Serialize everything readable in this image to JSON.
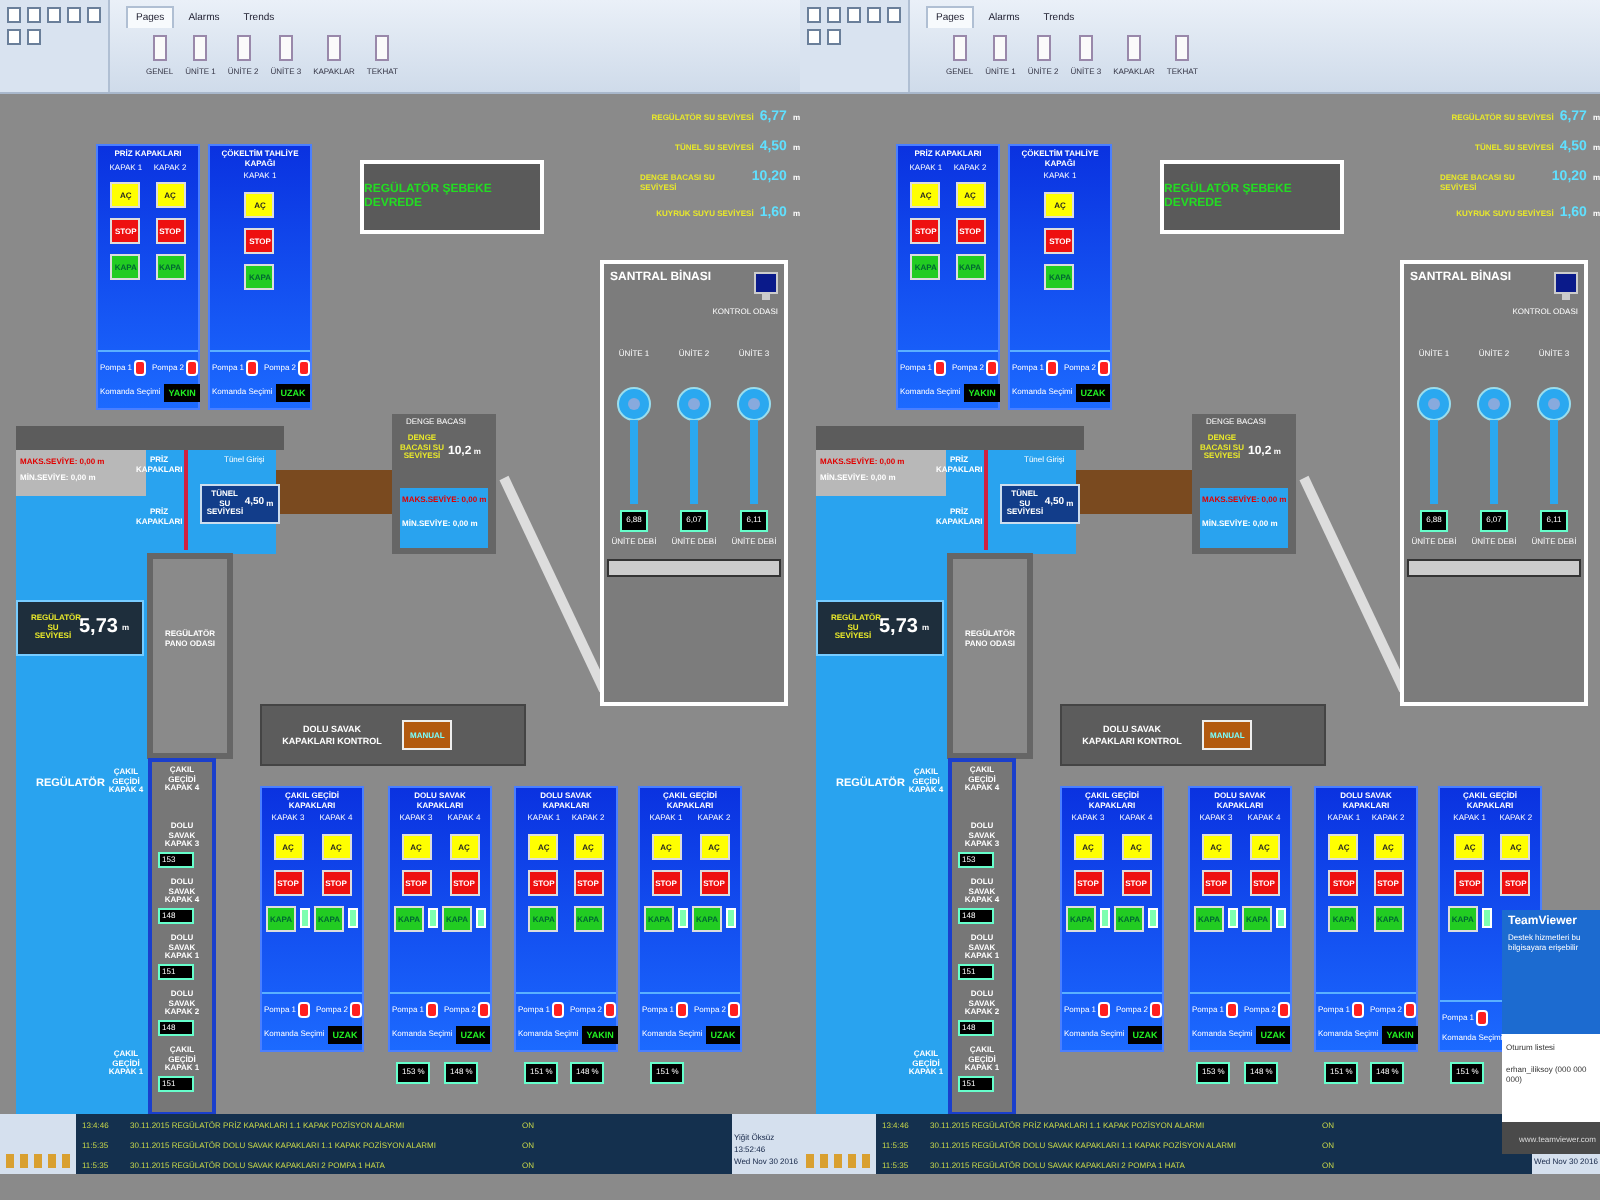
{
  "panes": [
    {
      "ribbon": {
        "tabs": [
          {
            "label": "Pages",
            "selected": true
          },
          {
            "label": "Alarms",
            "selected": false
          },
          {
            "label": "Trends",
            "selected": false
          }
        ],
        "pages": [
          "GENEL",
          "ÜNİTE 1",
          "ÜNİTE 2",
          "ÜNİTE 3",
          "KAPAKLAR",
          "TEKHAT"
        ]
      },
      "levels": [
        {
          "label": "REGÜLATÖR SU SEVİYESİ",
          "value": "6,77",
          "unit": "m"
        },
        {
          "label": "TÜNEL SU SEVİYESİ",
          "value": "4,50",
          "unit": "m"
        },
        {
          "label": "DENGE BACASI SU SEVİYESİ",
          "value": "10,20",
          "unit": "m"
        },
        {
          "label": "KUYRUK SUYU SEVİYESİ",
          "value": "1,60",
          "unit": "m"
        }
      ],
      "banner": "REGÜLATÖR ŞEBEKE DEVREDE",
      "top_panels": [
        {
          "title": "PRİZ KAPAKLARI",
          "gates": [
            {
              "label": "KAPAK 1",
              "buttons": [
                {
                  "label": "AÇ",
                  "kind": "open"
                },
                {
                  "label": "STOP",
                  "kind": "stop"
                },
                {
                  "label": "KAPA",
                  "kind": "close"
                }
              ]
            },
            {
              "label": "KAPAK 2",
              "buttons": [
                {
                  "label": "AÇ",
                  "kind": "open"
                },
                {
                  "label": "STOP",
                  "kind": "stop"
                },
                {
                  "label": "KAPA",
                  "kind": "close"
                }
              ]
            }
          ],
          "pumps": [
            {
              "label": "Pompa 1",
              "on": true
            },
            {
              "label": "Pompa 2",
              "on": true
            }
          ],
          "command": "Komanda Seçimi",
          "mode": "YAKIN"
        },
        {
          "title": "ÇÖKELTİM TAHLİYE KAPAĞI",
          "gates": [
            {
              "label": "KAPAK 1",
              "buttons": [
                {
                  "label": "AÇ",
                  "kind": "open"
                },
                {
                  "label": "STOP",
                  "kind": "stop"
                },
                {
                  "label": "KAPA",
                  "kind": "close"
                }
              ]
            }
          ],
          "pumps": [
            {
              "label": "Pompa 1",
              "on": true
            },
            {
              "label": "Pompa 2",
              "on": true
            }
          ],
          "command": "Komanda Seçimi",
          "mode": "UZAK"
        }
      ],
      "intake": {
        "max": "MAKS.SEVİYE: 0,00 m",
        "min": "MİN.SEVİYE: 0,00 m",
        "gates": [
          "PRİZ KAPAKLARI",
          "PRİZ KAPAKLARI"
        ],
        "tunnel_entry": "Tünel Girişi",
        "tunnel_label": "TÜNEL SU SEVİYESİ",
        "tunnel_value": "4,50",
        "tunnel_unit": "m"
      },
      "surge": {
        "title": "DENGE BACASI",
        "label": "DENGE BACASI SU SEVİYESİ",
        "value": "10,2",
        "unit": "m",
        "max": "MAKS.SEVİYE: 0,00 m",
        "min": "MİN.SEVİYE: 0,00 m"
      },
      "regulator": {
        "label": "REGÜLATÖR SU SEVİYESİ",
        "value": "5,73",
        "unit": "m",
        "room": "REGÜLATÖR PANO ODASI",
        "basin": "REGÜLATÖR"
      },
      "gate_column": [
        {
          "label": "ÇAKIL GEÇİDİ KAPAK 4"
        },
        {
          "label": "DOLU SAVAK KAPAK 3",
          "reading": "153"
        },
        {
          "label": "DOLU SAVAK KAPAK 4",
          "reading": "148"
        },
        {
          "label": "DOLU SAVAK KAPAK 1",
          "reading": "151"
        },
        {
          "label": "DOLU SAVAK KAPAK 2",
          "reading": "148"
        },
        {
          "label": "ÇAKIL GEÇİDİ KAPAK 1",
          "reading": "151"
        }
      ],
      "side_labels": [
        "ÇAKIL GEÇİDİ KAPAK 4",
        "ÇAKIL GEÇİDİ KAPAK 1"
      ],
      "plant": {
        "title": "SANTRAL BİNASI",
        "room": "KONTROL ODASI",
        "units": [
          {
            "label": "ÜNİTE 1",
            "reading": "6,88",
            "caption": "ÜNİTE DEBİ"
          },
          {
            "label": "ÜNİTE 2",
            "reading": "6,07",
            "caption": "ÜNİTE DEBİ"
          },
          {
            "label": "ÜNİTE 3",
            "reading": "6,11",
            "caption": "ÜNİTE DEBİ"
          }
        ]
      },
      "control": {
        "label": "DOLU SAVAK KAPAKLARI KONTROL",
        "button": "MANUAL"
      },
      "bottom_panels": [
        {
          "title": "ÇAKIL GEÇİDİ KAPAKLARI",
          "gates": [
            {
              "label": "KAPAK 3",
              "lamp": true,
              "buttons": [
                {
                  "label": "AÇ",
                  "kind": "open"
                },
                {
                  "label": "STOP",
                  "kind": "stop"
                },
                {
                  "label": "KAPA",
                  "kind": "close"
                }
              ]
            },
            {
              "label": "KAPAK 4",
              "lamp": true,
              "buttons": [
                {
                  "label": "AÇ",
                  "kind": "open"
                },
                {
                  "label": "STOP",
                  "kind": "stop"
                },
                {
                  "label": "KAPA",
                  "kind": "close"
                }
              ]
            }
          ],
          "pumps": [
            {
              "label": "Pompa 1",
              "on": true
            },
            {
              "label": "Pompa 2",
              "on": true
            }
          ],
          "command": "Komanda Seçimi",
          "mode": "UZAK"
        },
        {
          "title": "DOLU SAVAK KAPAKLARI",
          "gates": [
            {
              "label": "KAPAK 3",
              "lamp": true,
              "buttons": [
                {
                  "label": "AÇ",
                  "kind": "open"
                },
                {
                  "label": "STOP",
                  "kind": "stop"
                },
                {
                  "label": "KAPA",
                  "kind": "close"
                }
              ]
            },
            {
              "label": "KAPAK 4",
              "lamp": true,
              "buttons": [
                {
                  "label": "AÇ",
                  "kind": "open"
                },
                {
                  "label": "STOP",
                  "kind": "stop"
                },
                {
                  "label": "KAPA",
                  "kind": "close"
                }
              ]
            }
          ],
          "pumps": [
            {
              "label": "Pompa 1",
              "on": true
            },
            {
              "label": "Pompa 2",
              "on": true
            }
          ],
          "command": "Komanda Seçimi",
          "mode": "UZAK",
          "readings": [
            "153 %",
            "148 %"
          ]
        },
        {
          "title": "DOLU SAVAK KAPAKLARI",
          "gates": [
            {
              "label": "KAPAK 1",
              "buttons": [
                {
                  "label": "AÇ",
                  "kind": "open"
                },
                {
                  "label": "STOP",
                  "kind": "stop"
                },
                {
                  "label": "KAPA",
                  "kind": "close"
                }
              ]
            },
            {
              "label": "KAPAK 2",
              "buttons": [
                {
                  "label": "AÇ",
                  "kind": "open"
                },
                {
                  "label": "STOP",
                  "kind": "stop"
                },
                {
                  "label": "KAPA",
                  "kind": "close"
                }
              ]
            }
          ],
          "pumps": [
            {
              "label": "Pompa 1",
              "on": true
            },
            {
              "label": "Pompa 2",
              "on": true
            }
          ],
          "command": "Komanda Seçimi",
          "mode": "YAKIN",
          "readings": [
            "151 %",
            "148 %"
          ]
        },
        {
          "title": "ÇAKIL GEÇİDİ KAPAKLARI",
          "gates": [
            {
              "label": "KAPAK 1",
              "lamp": true,
              "buttons": [
                {
                  "label": "AÇ",
                  "kind": "open"
                },
                {
                  "label": "STOP",
                  "kind": "stop"
                },
                {
                  "label": "KAPA",
                  "kind": "close"
                }
              ]
            },
            {
              "label": "KAPAK 2",
              "lamp": true,
              "buttons": [
                {
                  "label": "AÇ",
                  "kind": "open"
                },
                {
                  "label": "STOP",
                  "kind": "stop"
                },
                {
                  "label": "KAPA",
                  "kind": "close"
                }
              ]
            }
          ],
          "pumps": [
            {
              "label": "Pompa 1",
              "on": true
            },
            {
              "label": "Pompa 2",
              "on": true
            }
          ],
          "command": "Komanda Seçimi",
          "mode": "UZAK",
          "readings": [
            "151 %"
          ]
        }
      ],
      "alarms": [
        {
          "time": "13:4:46",
          "text": "30.11.2015 REGÜLATÖR PRİZ KAPAKLARI 1.1 KAPAK POZİSYON ALARMI",
          "state": "ON"
        },
        {
          "time": "11:5:35",
          "text": "30.11.2015 REGÜLATÖR DOLU SAVAK KAPAKLARI 1.1 KAPAK POZİSYON ALARMI",
          "state": "ON"
        },
        {
          "time": "11:5:35",
          "text": "30.11.2015 REGÜLATÖR DOLU SAVAK KAPAKLARI 2 POMPA 1 HATA",
          "state": "ON"
        }
      ],
      "status": {
        "user": "Yiğit Öksüz",
        "time": "13:52:46",
        "date": "Wed Nov 30 2016"
      }
    },
    {
      "ribbon": {
        "tabs": [
          {
            "label": "Pages",
            "selected": true
          },
          {
            "label": "Alarms",
            "selected": false
          },
          {
            "label": "Trends",
            "selected": false
          }
        ],
        "pages": [
          "GENEL",
          "ÜNİTE 1",
          "ÜNİTE 2",
          "ÜNİTE 3",
          "KAPAKLAR",
          "TEKHAT"
        ]
      },
      "levels": [
        {
          "label": "REGÜLATÖR SU SEVİYESİ",
          "value": "6,77",
          "unit": "m"
        },
        {
          "label": "TÜNEL SU SEVİYESİ",
          "value": "4,50",
          "unit": "m"
        },
        {
          "label": "DENGE BACASI SU SEVİYESİ",
          "value": "10,20",
          "unit": "m"
        },
        {
          "label": "KUYRUK SUYU SEVİYESİ",
          "value": "1,60",
          "unit": "m"
        }
      ],
      "banner": "REGÜLATÖR ŞEBEKE DEVREDE",
      "top_panels": [
        {
          "title": "PRİZ KAPAKLARI",
          "gates": [
            {
              "label": "KAPAK 1",
              "buttons": [
                {
                  "label": "AÇ",
                  "kind": "open"
                },
                {
                  "label": "STOP",
                  "kind": "stop"
                },
                {
                  "label": "KAPA",
                  "kind": "close"
                }
              ]
            },
            {
              "label": "KAPAK 2",
              "buttons": [
                {
                  "label": "AÇ",
                  "kind": "open"
                },
                {
                  "label": "STOP",
                  "kind": "stop"
                },
                {
                  "label": "KAPA",
                  "kind": "close"
                }
              ]
            }
          ],
          "pumps": [
            {
              "label": "Pompa 1",
              "on": true
            },
            {
              "label": "Pompa 2",
              "on": true
            }
          ],
          "command": "Komanda Seçimi",
          "mode": "YAKIN"
        },
        {
          "title": "ÇÖKELTİM TAHLİYE KAPAĞI",
          "gates": [
            {
              "label": "KAPAK 1",
              "buttons": [
                {
                  "label": "AÇ",
                  "kind": "open"
                },
                {
                  "label": "STOP",
                  "kind": "stop"
                },
                {
                  "label": "KAPA",
                  "kind": "close"
                }
              ]
            }
          ],
          "pumps": [
            {
              "label": "Pompa 1",
              "on": true
            },
            {
              "label": "Pompa 2",
              "on": true
            }
          ],
          "command": "Komanda Seçimi",
          "mode": "UZAK"
        }
      ],
      "intake": {
        "max": "MAKS.SEVİYE: 0,00 m",
        "min": "MİN.SEVİYE: 0,00 m",
        "gates": [
          "PRİZ KAPAKLARI",
          "PRİZ KAPAKLARI"
        ],
        "tunnel_entry": "Tünel Girişi",
        "tunnel_label": "TÜNEL SU SEVİYESİ",
        "tunnel_value": "4,50",
        "tunnel_unit": "m"
      },
      "surge": {
        "title": "DENGE BACASI",
        "label": "DENGE BACASI SU SEVİYESİ",
        "value": "10,2",
        "unit": "m",
        "max": "MAKS.SEVİYE: 0,00 m",
        "min": "MİN.SEVİYE: 0,00 m"
      },
      "regulator": {
        "label": "REGÜLATÖR SU SEVİYESİ",
        "value": "5,73",
        "unit": "m",
        "room": "REGÜLATÖR PANO ODASI",
        "basin": "REGÜLATÖR"
      },
      "gate_column": [
        {
          "label": "ÇAKIL GEÇİDİ KAPAK 4"
        },
        {
          "label": "DOLU SAVAK KAPAK 3",
          "reading": "153"
        },
        {
          "label": "DOLU SAVAK KAPAK 4",
          "reading": "148"
        },
        {
          "label": "DOLU SAVAK KAPAK 1",
          "reading": "151"
        },
        {
          "label": "DOLU SAVAK KAPAK 2",
          "reading": "148"
        },
        {
          "label": "ÇAKIL GEÇİDİ KAPAK 1",
          "reading": "151"
        }
      ],
      "side_labels": [
        "ÇAKIL GEÇİDİ KAPAK 4",
        "ÇAKIL GEÇİDİ KAPAK 1"
      ],
      "plant": {
        "title": "SANTRAL BİNASI",
        "room": "KONTROL ODASI",
        "units": [
          {
            "label": "ÜNİTE 1",
            "reading": "6,88",
            "caption": "ÜNİTE DEBİ"
          },
          {
            "label": "ÜNİTE 2",
            "reading": "6,07",
            "caption": "ÜNİTE DEBİ"
          },
          {
            "label": "ÜNİTE 3",
            "reading": "6,11",
            "caption": "ÜNİTE DEBİ"
          }
        ]
      },
      "control": {
        "label": "DOLU SAVAK KAPAKLARI KONTROL",
        "button": "MANUAL"
      },
      "bottom_panels": [
        {
          "title": "ÇAKIL GEÇİDİ KAPAKLARI",
          "gates": [
            {
              "label": "KAPAK 3",
              "lamp": true,
              "buttons": [
                {
                  "label": "AÇ",
                  "kind": "open"
                },
                {
                  "label": "STOP",
                  "kind": "stop"
                },
                {
                  "label": "KAPA",
                  "kind": "close"
                }
              ]
            },
            {
              "label": "KAPAK 4",
              "lamp": true,
              "buttons": [
                {
                  "label": "AÇ",
                  "kind": "open"
                },
                {
                  "label": "STOP",
                  "kind": "stop"
                },
                {
                  "label": "KAPA",
                  "kind": "close"
                }
              ]
            }
          ],
          "pumps": [
            {
              "label": "Pompa 1",
              "on": true
            },
            {
              "label": "Pompa 2",
              "on": true
            }
          ],
          "command": "Komanda Seçimi",
          "mode": "UZAK"
        },
        {
          "title": "DOLU SAVAK KAPAKLARI",
          "gates": [
            {
              "label": "KAPAK 3",
              "lamp": true,
              "buttons": [
                {
                  "label": "AÇ",
                  "kind": "open"
                },
                {
                  "label": "STOP",
                  "kind": "stop"
                },
                {
                  "label": "KAPA",
                  "kind": "close"
                }
              ]
            },
            {
              "label": "KAPAK 4",
              "lamp": true,
              "buttons": [
                {
                  "label": "AÇ",
                  "kind": "open"
                },
                {
                  "label": "STOP",
                  "kind": "stop"
                },
                {
                  "label": "KAPA",
                  "kind": "close"
                }
              ]
            }
          ],
          "pumps": [
            {
              "label": "Pompa 1",
              "on": true
            },
            {
              "label": "Pompa 2",
              "on": true
            }
          ],
          "command": "Komanda Seçimi",
          "mode": "UZAK",
          "readings": [
            "153 %",
            "148 %"
          ]
        },
        {
          "title": "DOLU SAVAK KAPAKLARI",
          "gates": [
            {
              "label": "KAPAK 1",
              "buttons": [
                {
                  "label": "AÇ",
                  "kind": "open"
                },
                {
                  "label": "STOP",
                  "kind": "stop"
                },
                {
                  "label": "KAPA",
                  "kind": "close"
                }
              ]
            },
            {
              "label": "KAPAK 2",
              "buttons": [
                {
                  "label": "AÇ",
                  "kind": "open"
                },
                {
                  "label": "STOP",
                  "kind": "stop"
                },
                {
                  "label": "KAPA",
                  "kind": "close"
                }
              ]
            }
          ],
          "pumps": [
            {
              "label": "Pompa 1",
              "on": true
            },
            {
              "label": "Pompa 2",
              "on": true
            }
          ],
          "command": "Komanda Seçimi",
          "mode": "YAKIN",
          "readings": [
            "151 %",
            "148 %"
          ]
        },
        {
          "title": "ÇAKIL GEÇİDİ KAPAKLARI",
          "gates": [
            {
              "label": "KAPAK 1",
              "lamp": true,
              "buttons": [
                {
                  "label": "AÇ",
                  "kind": "open"
                },
                {
                  "label": "STOP",
                  "kind": "stop"
                },
                {
                  "label": "KAPA",
                  "kind": "close"
                }
              ]
            },
            {
              "label": "KAPAK 2",
              "buttons": [
                {
                  "label": "AÇ",
                  "kind": "open"
                },
                {
                  "label": "STOP",
                  "kind": "stop"
                }
              ]
            }
          ],
          "pumps": [
            {
              "label": "Pompa 1",
              "on": true
            }
          ],
          "command": "Komanda Seçimi",
          "readings": [
            "151 %"
          ]
        }
      ],
      "alarms": [
        {
          "time": "13:4:46",
          "text": "30.11.2015 REGÜLATÖR PRİZ KAPAKLARI 1.1 KAPAK POZİSYON ALARMI",
          "state": "ON"
        },
        {
          "time": "11:5:35",
          "text": "30.11.2015 REGÜLATÖR DOLU SAVAK KAPAKLARI 1.1 KAPAK POZİSYON ALARMI",
          "state": "ON"
        },
        {
          "time": "11:5:35",
          "text": "30.11.2015 REGÜLATÖR DOLU SAVAK KAPAKLARI 2 POMPA 1 HATA",
          "state": "ON"
        }
      ],
      "status": {
        "date": "Wed Nov 30 2016"
      }
    }
  ],
  "teamviewer": {
    "title": "TeamViewer",
    "subtitle": "Destek hizmetleri bu bilgisayara erişebilir",
    "session_list": "Oturum listesi",
    "session": "erhan_iliksoy (000 000 000)",
    "link": "www.teamviewer.com"
  }
}
